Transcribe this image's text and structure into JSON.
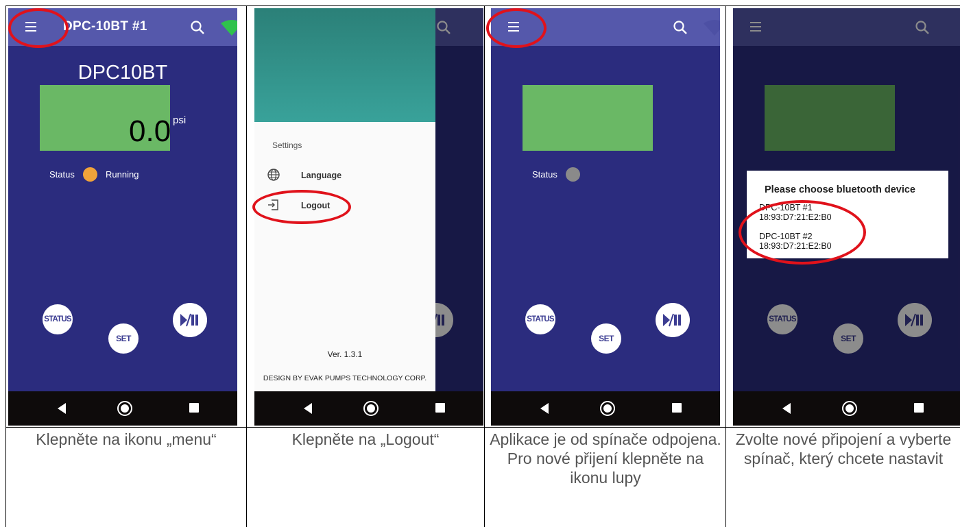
{
  "colors": {
    "background": "#2b2c7e",
    "app_bar": "#5558ab",
    "display_green": "#6ab865",
    "status_running": "#f0a33a",
    "status_idle": "#8a8a8a",
    "wifi_green": "#2fc24c",
    "nav_bar": "#0e0b0b",
    "drawer_header": "#33958c",
    "highlight_red": "#e0121b"
  },
  "panel1": {
    "title": "DPC-10BT #1",
    "device_name": "DPC10BT",
    "pressure_value": "0.0",
    "pressure_unit": "psi",
    "status_label": "Status",
    "status_text": "Running",
    "btn_status": "STATUS",
    "btn_set": "SET",
    "icons": [
      "menu-icon",
      "search-icon",
      "wifi-icon",
      "play-pause-icon"
    ]
  },
  "panel2": {
    "section": "Settings",
    "items": [
      {
        "label": "Language",
        "icon": "globe-icon"
      },
      {
        "label": "Logout",
        "icon": "logout-icon"
      }
    ],
    "version": "Ver. 1.3.1",
    "credit": "DESIGN BY EVAK PUMPS TECHNOLOGY CORP."
  },
  "panel3": {
    "status_label": "Status",
    "btn_status": "STATUS",
    "btn_set": "SET"
  },
  "panel4": {
    "dialog_title": "Please choose bluetooth device",
    "devices": [
      {
        "name": "DPC-10BT #1",
        "address": "18:93:D7:21:E2:B0"
      },
      {
        "name": "DPC-10BT #2",
        "address": "18:93:D7:21:E2:B0"
      }
    ],
    "btn_status": "STATUS",
    "btn_set": "SET"
  },
  "captions": [
    "Klepněte na ikonu „menu“",
    "Klepněte na „Logout“",
    "Aplikace je od spínače odpojena. Pro nové přijení klepněte na ikonu lupy",
    "Zvolte nové připojení a vyberte spínač, který chcete nastavit"
  ]
}
